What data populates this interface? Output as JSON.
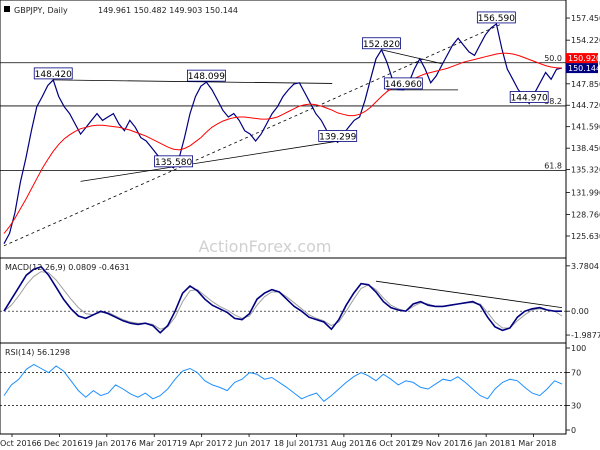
{
  "chart_data": [
    {
      "panel": "price",
      "type": "line",
      "title": "GBPJPY, Daily",
      "ohlc_label": "149.961 150.482 149.903 150.144",
      "ylim": [
        123.0,
        159.5
      ],
      "y_ticks": [
        157.45,
        154.22,
        150.92,
        147.85,
        144.72,
        141.59,
        138.45,
        135.32,
        131.99,
        128.76,
        125.63
      ],
      "x_ticks": [
        "21 Oct 2016",
        "6 Dec 2016",
        "19 Jan 2017",
        "6 Mar 2017",
        "19 Apr 2017",
        "2 Jun 2017",
        "18 Jul 2017",
        "31 Aug 2017",
        "16 Oct 2017",
        "29 Nov 2017",
        "16 Jan 2018",
        "1 Mar 2018"
      ],
      "series": [
        {
          "role": "close",
          "values": [
            124.5,
            126.0,
            129.0,
            133.5,
            137.0,
            141.0,
            144.5,
            146.0,
            147.6,
            148.42,
            146.0,
            144.5,
            143.5,
            142.0,
            140.5,
            141.5,
            142.5,
            143.5,
            142.5,
            143.0,
            143.5,
            142.0,
            141.0,
            142.5,
            141.5,
            140.0,
            139.5,
            138.5,
            137.5,
            136.5,
            136.0,
            135.58,
            137.0,
            140.0,
            143.5,
            146.0,
            147.5,
            148.09,
            147.0,
            145.5,
            144.0,
            143.0,
            143.5,
            142.5,
            141.0,
            140.5,
            139.5,
            140.5,
            142.0,
            143.5,
            144.5,
            146.0,
            147.0,
            147.8,
            148.0,
            146.5,
            145.0,
            143.5,
            142.5,
            141.0,
            140.0,
            139.29,
            140.5,
            141.5,
            142.5,
            143.0,
            145.5,
            148.5,
            151.5,
            152.82,
            151.0,
            148.5,
            147.0,
            146.96,
            148.0,
            150.0,
            151.5,
            150.0,
            148.0,
            149.0,
            150.5,
            152.0,
            153.5,
            154.5,
            153.5,
            152.5,
            152.0,
            153.5,
            155.0,
            156.0,
            156.59,
            153.0,
            150.0,
            148.5,
            147.0,
            146.0,
            144.97,
            146.5,
            148.0,
            149.5,
            148.5,
            149.96,
            150.144
          ],
          "color": "#000080"
        },
        {
          "role": "moving-average",
          "values": [
            126.0,
            127.0,
            128.2,
            129.6,
            131.0,
            132.5,
            134.0,
            135.5,
            136.8,
            138.0,
            139.0,
            139.8,
            140.4,
            140.9,
            141.3,
            141.5,
            141.7,
            141.8,
            141.8,
            141.7,
            141.6,
            141.5,
            141.3,
            141.1,
            140.8,
            140.5,
            140.2,
            139.8,
            139.4,
            139.0,
            138.6,
            138.3,
            138.2,
            138.4,
            138.8,
            139.4,
            140.0,
            140.8,
            141.5,
            142.0,
            142.4,
            142.7,
            142.9,
            143.0,
            143.0,
            142.9,
            142.8,
            142.7,
            142.7,
            142.8,
            143.0,
            143.4,
            143.8,
            144.2,
            144.6,
            144.8,
            144.9,
            144.8,
            144.6,
            144.3,
            144.0,
            143.6,
            143.4,
            143.2,
            143.2,
            143.4,
            143.8,
            144.4,
            145.2,
            146.0,
            146.7,
            147.2,
            147.6,
            147.9,
            148.2,
            148.6,
            149.0,
            149.3,
            149.5,
            149.7,
            149.9,
            150.1,
            150.4,
            150.7,
            151.0,
            151.2,
            151.4,
            151.6,
            151.8,
            152.0,
            152.2,
            152.3,
            152.3,
            152.2,
            152.0,
            151.7,
            151.4,
            151.1,
            150.8,
            150.5,
            150.3,
            150.2,
            150.144
          ],
          "color": "#ff0000"
        }
      ],
      "trendlines": [
        {
          "from": [
            0,
            124.2
          ],
          "to": [
            91,
            156.6
          ],
          "style": "dashed"
        },
        {
          "from": [
            14,
            133.6
          ],
          "to": [
            62,
            139.6
          ],
          "style": "solid"
        },
        {
          "from": [
            9,
            148.42
          ],
          "to": [
            60,
            147.9
          ],
          "style": "solid"
        },
        {
          "from": [
            69,
            152.82
          ],
          "to": [
            80,
            150.8
          ],
          "style": "solid"
        },
        {
          "from": [
            70,
            146.96
          ],
          "to": [
            83,
            146.96
          ],
          "style": "solid"
        }
      ],
      "hlines": [
        {
          "value": 150.92,
          "label": "50.0"
        },
        {
          "value": 144.62,
          "label": "38.2"
        },
        {
          "value": 135.19,
          "label": "61.8"
        }
      ],
      "price_labels": [
        {
          "text": "148.420",
          "x": 9,
          "y": 148.42
        },
        {
          "text": "148.099",
          "x": 37,
          "y": 148.09
        },
        {
          "text": "135.580",
          "x": 31,
          "y": 135.58
        },
        {
          "text": "152.820",
          "x": 69,
          "y": 152.82
        },
        {
          "text": "146.960",
          "x": 73,
          "y": 146.96
        },
        {
          "text": "139.299",
          "x": 61,
          "y": 139.29
        },
        {
          "text": "156.590",
          "x": 90,
          "y": 156.59
        },
        {
          "text": "144.970",
          "x": 96,
          "y": 144.97
        }
      ],
      "current_price": {
        "value": 150.144,
        "label": "150.144",
        "ma_label": "150.920"
      },
      "watermark": "ActionForex.com"
    },
    {
      "panel": "macd",
      "type": "line",
      "label": "MACD(12,26,9) 0.0809 -0.4631",
      "ylim": [
        -2.4,
        4.1
      ],
      "y_ticks": [
        3.7804,
        0.0,
        -1.9877
      ],
      "zero_line": true,
      "series": [
        {
          "role": "macd",
          "color": "#000080",
          "values": [
            0.0,
            1.0,
            2.0,
            3.0,
            3.5,
            3.7,
            3.0,
            2.0,
            1.0,
            0.2,
            -0.4,
            -0.6,
            -0.3,
            0.0,
            -0.2,
            -0.5,
            -0.8,
            -1.0,
            -1.1,
            -1.0,
            -1.2,
            -1.8,
            -1.2,
            0.0,
            1.5,
            2.1,
            1.7,
            1.0,
            0.5,
            0.2,
            -0.1,
            -0.6,
            -0.7,
            -0.2,
            1.0,
            1.5,
            1.8,
            1.6,
            1.0,
            0.4,
            0.0,
            -0.5,
            -0.7,
            -0.9,
            -1.5,
            -0.7,
            0.5,
            1.5,
            2.3,
            2.2,
            1.6,
            0.8,
            0.3,
            0.1,
            0.0,
            0.6,
            0.8,
            0.5,
            0.4,
            0.4,
            0.5,
            0.6,
            0.7,
            0.8,
            0.5,
            -0.5,
            -1.3,
            -1.6,
            -1.4,
            -0.5,
            0.0,
            0.2,
            0.3,
            0.1,
            0.0,
            0.0
          ]
        },
        {
          "role": "signal",
          "color": "#a0a0a0",
          "values": [
            0.0,
            0.5,
            1.3,
            2.2,
            2.9,
            3.3,
            3.2,
            2.6,
            1.8,
            1.0,
            0.3,
            -0.2,
            -0.3,
            -0.1,
            -0.1,
            -0.4,
            -0.7,
            -0.9,
            -1.0,
            -1.0,
            -1.1,
            -1.5,
            -1.3,
            -0.5,
            0.8,
            1.7,
            1.8,
            1.3,
            0.8,
            0.4,
            0.1,
            -0.3,
            -0.6,
            -0.4,
            0.5,
            1.2,
            1.6,
            1.6,
            1.2,
            0.7,
            0.2,
            -0.3,
            -0.6,
            -0.8,
            -1.2,
            -0.9,
            0.0,
            1.0,
            1.9,
            2.2,
            1.8,
            1.1,
            0.5,
            0.2,
            0.0,
            0.4,
            0.7,
            0.6,
            0.4,
            0.4,
            0.5,
            0.6,
            0.7,
            0.7,
            0.6,
            -0.1,
            -0.9,
            -1.4,
            -1.4,
            -0.8,
            -0.3,
            0.1,
            0.2,
            0.1,
            0.0,
            -0.4
          ]
        }
      ],
      "trendline": {
        "from": [
          50,
          2.5
        ],
        "to": [
          75,
          0.3
        ],
        "style": "solid"
      }
    },
    {
      "panel": "rsi",
      "type": "line",
      "label": "RSI(14) 56.1298",
      "ylim": [
        0,
        100
      ],
      "y_ticks": [
        100,
        70,
        30,
        0
      ],
      "hlines": [
        70,
        30
      ],
      "series": [
        {
          "role": "rsi",
          "color": "#1e90ff",
          "values": [
            42,
            55,
            62,
            74,
            80,
            75,
            70,
            78,
            72,
            60,
            48,
            40,
            48,
            42,
            45,
            55,
            50,
            44,
            40,
            45,
            38,
            42,
            50,
            62,
            72,
            75,
            70,
            60,
            55,
            52,
            48,
            58,
            62,
            70,
            68,
            62,
            64,
            58,
            52,
            45,
            38,
            42,
            45,
            35,
            42,
            50,
            58,
            65,
            70,
            66,
            60,
            68,
            62,
            55,
            60,
            58,
            52,
            50,
            56,
            62,
            60,
            65,
            58,
            50,
            42,
            38,
            50,
            58,
            62,
            60,
            52,
            45,
            42,
            50,
            60,
            56
          ]
        }
      ]
    }
  ]
}
